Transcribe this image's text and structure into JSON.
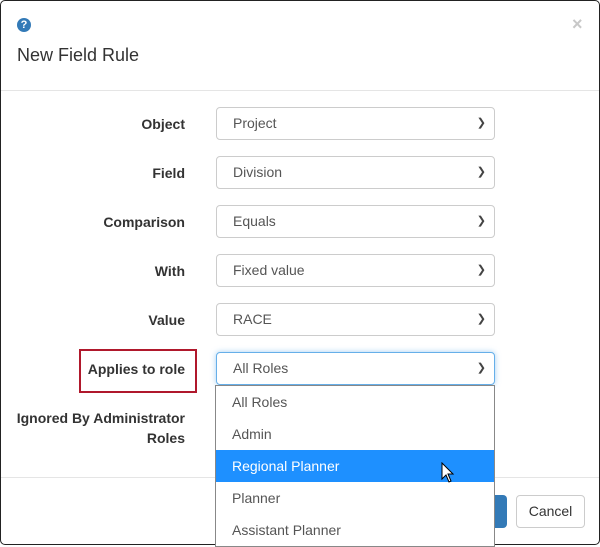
{
  "dialog": {
    "title": "New Field Rule",
    "close_label": "×",
    "help_icon": "?"
  },
  "form": {
    "rows": [
      {
        "label": "Object",
        "value": "Project"
      },
      {
        "label": "Field",
        "value": "Division"
      },
      {
        "label": "Comparison",
        "value": "Equals"
      },
      {
        "label": "With",
        "value": "Fixed value"
      },
      {
        "label": "Value",
        "value": "RACE"
      },
      {
        "label": "Applies to role",
        "value": "All Roles"
      }
    ],
    "ignored_label": "Ignored By Administrator Roles"
  },
  "dropdown": {
    "options": [
      "All Roles",
      "Admin",
      "Regional Planner",
      "Planner",
      "Assistant Planner"
    ],
    "highlighted": "Regional Planner"
  },
  "footer": {
    "cancel_label": "Cancel"
  },
  "colors": {
    "accent": "#337ab7",
    "highlight": "#1e90ff",
    "annotation": "#b0182c"
  }
}
